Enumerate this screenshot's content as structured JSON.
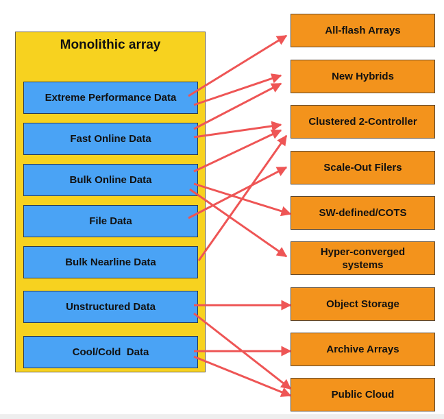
{
  "title": "Monolithic array",
  "colors": {
    "container": "#f7d21f",
    "source_box": "#4aa3f5",
    "target_box": "#f3931c",
    "arrow": "#ee5555"
  },
  "sources": [
    {
      "id": "extreme",
      "label": "Extreme Performance Data"
    },
    {
      "id": "fast",
      "label": "Fast Online Data"
    },
    {
      "id": "bulk",
      "label": "Bulk Online Data"
    },
    {
      "id": "file",
      "label": "File Data"
    },
    {
      "id": "nearline",
      "label": "Bulk Nearline Data"
    },
    {
      "id": "unstructured",
      "label": "Unstructured Data"
    },
    {
      "id": "cold",
      "label": "Cool/Cold  Data"
    }
  ],
  "targets": [
    {
      "id": "allflash",
      "label": "All-flash Arrays"
    },
    {
      "id": "hybrids",
      "label": "New Hybrids"
    },
    {
      "id": "clustered",
      "label": "Clustered 2-Controller"
    },
    {
      "id": "scaleout",
      "label": "Scale-Out Filers"
    },
    {
      "id": "swdefined",
      "label": "SW-defined/COTS"
    },
    {
      "id": "hyperconverged",
      "label": "Hyper-converged systems"
    },
    {
      "id": "object",
      "label": "Object Storage"
    },
    {
      "id": "archive",
      "label": "Archive Arrays"
    },
    {
      "id": "cloud",
      "label": "Public Cloud"
    }
  ],
  "edges": [
    {
      "from": "extreme",
      "to": "allflash"
    },
    {
      "from": "extreme",
      "to": "hybrids"
    },
    {
      "from": "fast",
      "to": "hybrids"
    },
    {
      "from": "fast",
      "to": "clustered"
    },
    {
      "from": "bulk",
      "to": "clustered"
    },
    {
      "from": "nearline",
      "to": "clustered"
    },
    {
      "from": "file",
      "to": "scaleout"
    },
    {
      "from": "bulk",
      "to": "swdefined"
    },
    {
      "from": "bulk",
      "to": "hyperconverged"
    },
    {
      "from": "unstructured",
      "to": "object"
    },
    {
      "from": "unstructured",
      "to": "cloud"
    },
    {
      "from": "cold",
      "to": "archive"
    },
    {
      "from": "cold",
      "to": "cloud"
    }
  ]
}
